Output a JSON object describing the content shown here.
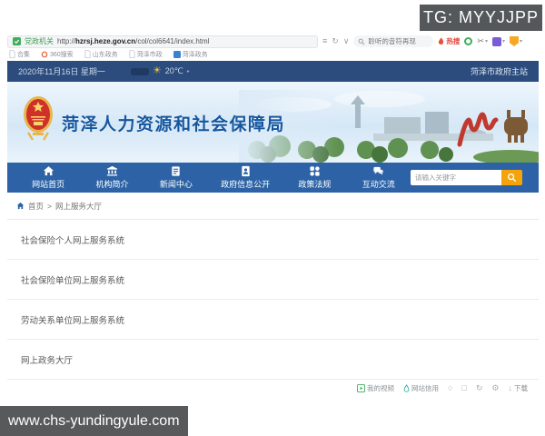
{
  "overlay": {
    "tg_badge": "TG: MYYJJPP",
    "site_watermark": "www.chs-yundingyule.com"
  },
  "browser": {
    "address_bar": {
      "badge": "党政机关",
      "url_prefix": "http://",
      "url_host": "hzrsj.heze.gov.cn",
      "url_path": "/col/col6641/index.html"
    },
    "omnibox": {
      "hotword": "聆听的音符再现",
      "hot_label": "热搜"
    },
    "bookmarks": [
      "合集",
      "360搜索",
      "山东政务",
      "菏泽市政",
      "菏泽政务"
    ],
    "statusbar": {
      "my_video": "我的视频",
      "site_credit": "网站信用",
      "download": "下载"
    }
  },
  "site": {
    "topbar": {
      "date": "2020年11月16日 星期一",
      "temperature": "20℃",
      "gov_link": "菏泽市政府主站"
    },
    "header": {
      "title": "菏泽人力资源和社会保障局"
    },
    "nav": {
      "items": [
        "网站首页",
        "机构简介",
        "新闻中心",
        "政府信息公开",
        "政策法规",
        "互动交流"
      ],
      "search_placeholder": "请输入关键字"
    },
    "breadcrumb": {
      "home": "首页",
      "separator": ">",
      "current": "网上服务大厅"
    },
    "services": [
      "社会保险个人网上服务系统",
      "社会保险单位网上服务系统",
      "劳动关系单位网上服务系统",
      "网上政务大厅"
    ],
    "colors": {
      "topbar_navy": "#2b4c7d",
      "nav_blue": "#2d63a6",
      "title_blue": "#15579f",
      "accent_orange": "#f5a30a"
    }
  }
}
